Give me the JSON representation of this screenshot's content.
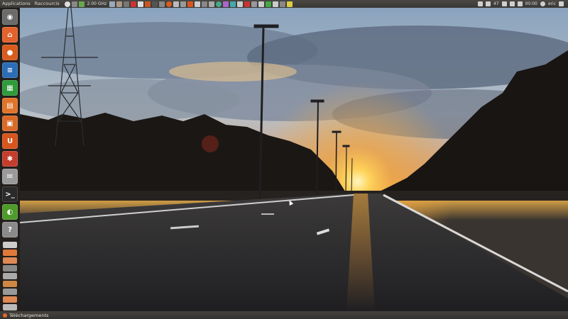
{
  "top_panel": {
    "menus": [
      "Applications",
      "Raccourcis"
    ],
    "cpu_freq": "2.00 GHz",
    "clock": "00:00",
    "user": "eric",
    "volume": "47"
  },
  "launcher": {
    "items": [
      {
        "name": "ubuntu-home-icon",
        "glyph": "◉",
        "color": "#6b6b6b"
      },
      {
        "name": "home-folder-icon",
        "glyph": "⌂",
        "color": "#e2622d"
      },
      {
        "name": "firefox-icon",
        "glyph": "●",
        "color": "#d85c1e"
      },
      {
        "name": "writer-icon",
        "glyph": "≡",
        "color": "#2d6db5"
      },
      {
        "name": "calc-icon",
        "glyph": "▦",
        "color": "#2f9b3a"
      },
      {
        "name": "impress-icon",
        "glyph": "▤",
        "color": "#e0742a"
      },
      {
        "name": "software-center-icon",
        "glyph": "▣",
        "color": "#d86a2a"
      },
      {
        "name": "ubuntu-one-icon",
        "glyph": "U",
        "color": "#d8561e"
      },
      {
        "name": "settings-icon",
        "glyph": "✱",
        "color": "#c43e2e"
      },
      {
        "name": "mail-icon",
        "glyph": "✉",
        "color": "#9a9a9a"
      },
      {
        "name": "terminal-icon",
        "glyph": ">_",
        "color": "#2a2a2a"
      },
      {
        "name": "nvidia-icon",
        "glyph": "◐",
        "color": "#4e9a2a"
      },
      {
        "name": "help-icon",
        "glyph": "?",
        "color": "#8a8a8a"
      }
    ]
  },
  "taskbar": {
    "downloads_label": "Téléchargements"
  }
}
